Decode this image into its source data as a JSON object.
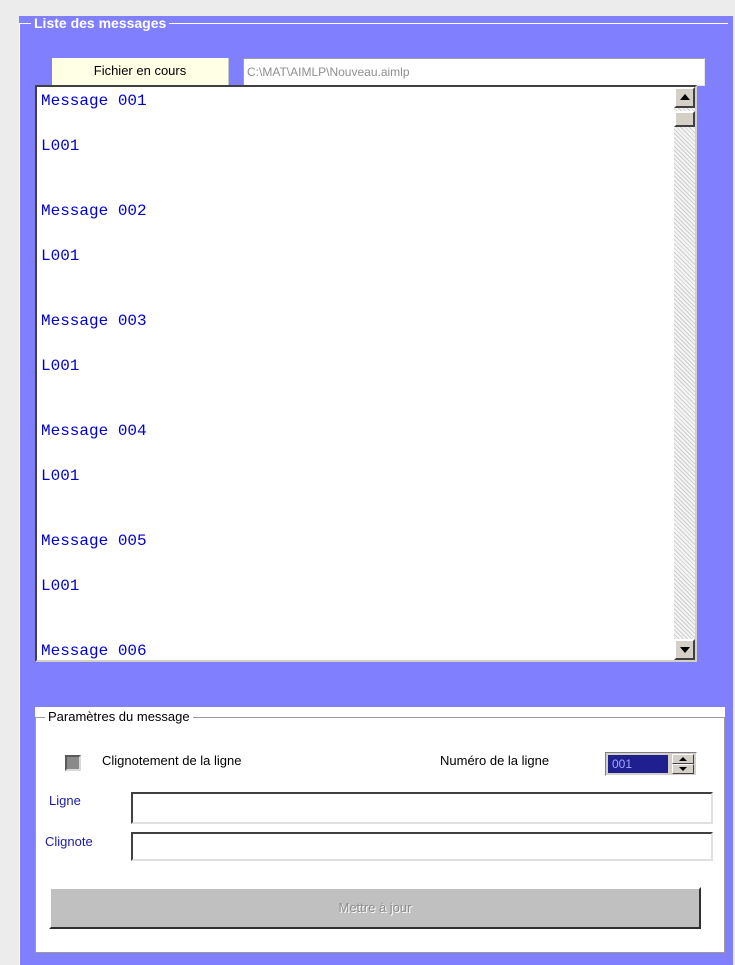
{
  "messages_group": {
    "legend": "Liste des messages",
    "file_label": "Fichier en cours",
    "file_path": "C:\\MAT\\AIMLP\\Nouveau.aimlp",
    "messages": [
      {
        "title": "Message 001",
        "line": "L001"
      },
      {
        "title": "Message 002",
        "line": "L001"
      },
      {
        "title": "Message 003",
        "line": "L001"
      },
      {
        "title": "Message 004",
        "line": "L001"
      },
      {
        "title": "Message 005",
        "line": "L001"
      },
      {
        "title": "Message 006",
        "line": ""
      }
    ]
  },
  "params_group": {
    "legend": "Paramètres du message",
    "blink_checkbox_label": "Clignotement de la ligne",
    "blink_checked": false,
    "line_number_label": "Numéro de la ligne",
    "line_number_value": "001",
    "ligne_label": "Ligne",
    "ligne_value": "",
    "clignote_label": "Clignote",
    "clignote_value": "",
    "update_button": "Mettre à jour"
  },
  "colors": {
    "panel_background": "#8080ff",
    "message_text": "#0000cc",
    "field_label": "#1a1aa6",
    "selected_number_background": "#1f1f8f"
  },
  "icons": {
    "scroll_up": "arrow-up-icon",
    "scroll_down": "arrow-down-icon",
    "spin_up": "spin-up-icon",
    "spin_down": "spin-down-icon"
  }
}
